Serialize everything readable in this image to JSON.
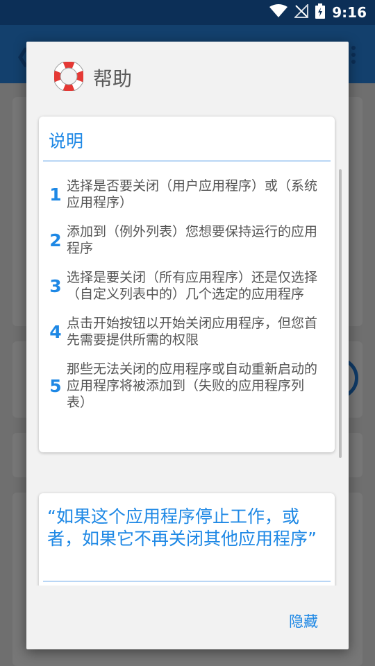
{
  "status_bar": {
    "time": "9:16"
  },
  "dialog": {
    "title": "帮助",
    "instructions_title": "说明",
    "steps": [
      {
        "num": "1",
        "text": "选择是否要关闭（用户应用程序）或（系统应用程序）"
      },
      {
        "num": "2",
        "text": "添加到（例外列表）您想要保持运行的应用程序"
      },
      {
        "num": "3",
        "text": "选择是要关闭（所有应用程序）还是仅选择（自定义列表中的）几个选定的应用程序"
      },
      {
        "num": "4",
        "text": "点击开始按钮以开始关闭应用程序，但您首先需要提供所需的权限"
      },
      {
        "num": "5",
        "text": "那些无法关闭的应用程序或自动重新启动的应用程序将被添加到（失败的应用程序列表）"
      }
    ],
    "faq_question": "“如果这个应用程序停止工作，或者，如果它不再关闭其他应用程序”",
    "hide_label": "隐藏"
  },
  "colors": {
    "accent": "#1e88e5",
    "status_bar": "#0c2f57",
    "dialog_bg": "#f2f2f2"
  }
}
